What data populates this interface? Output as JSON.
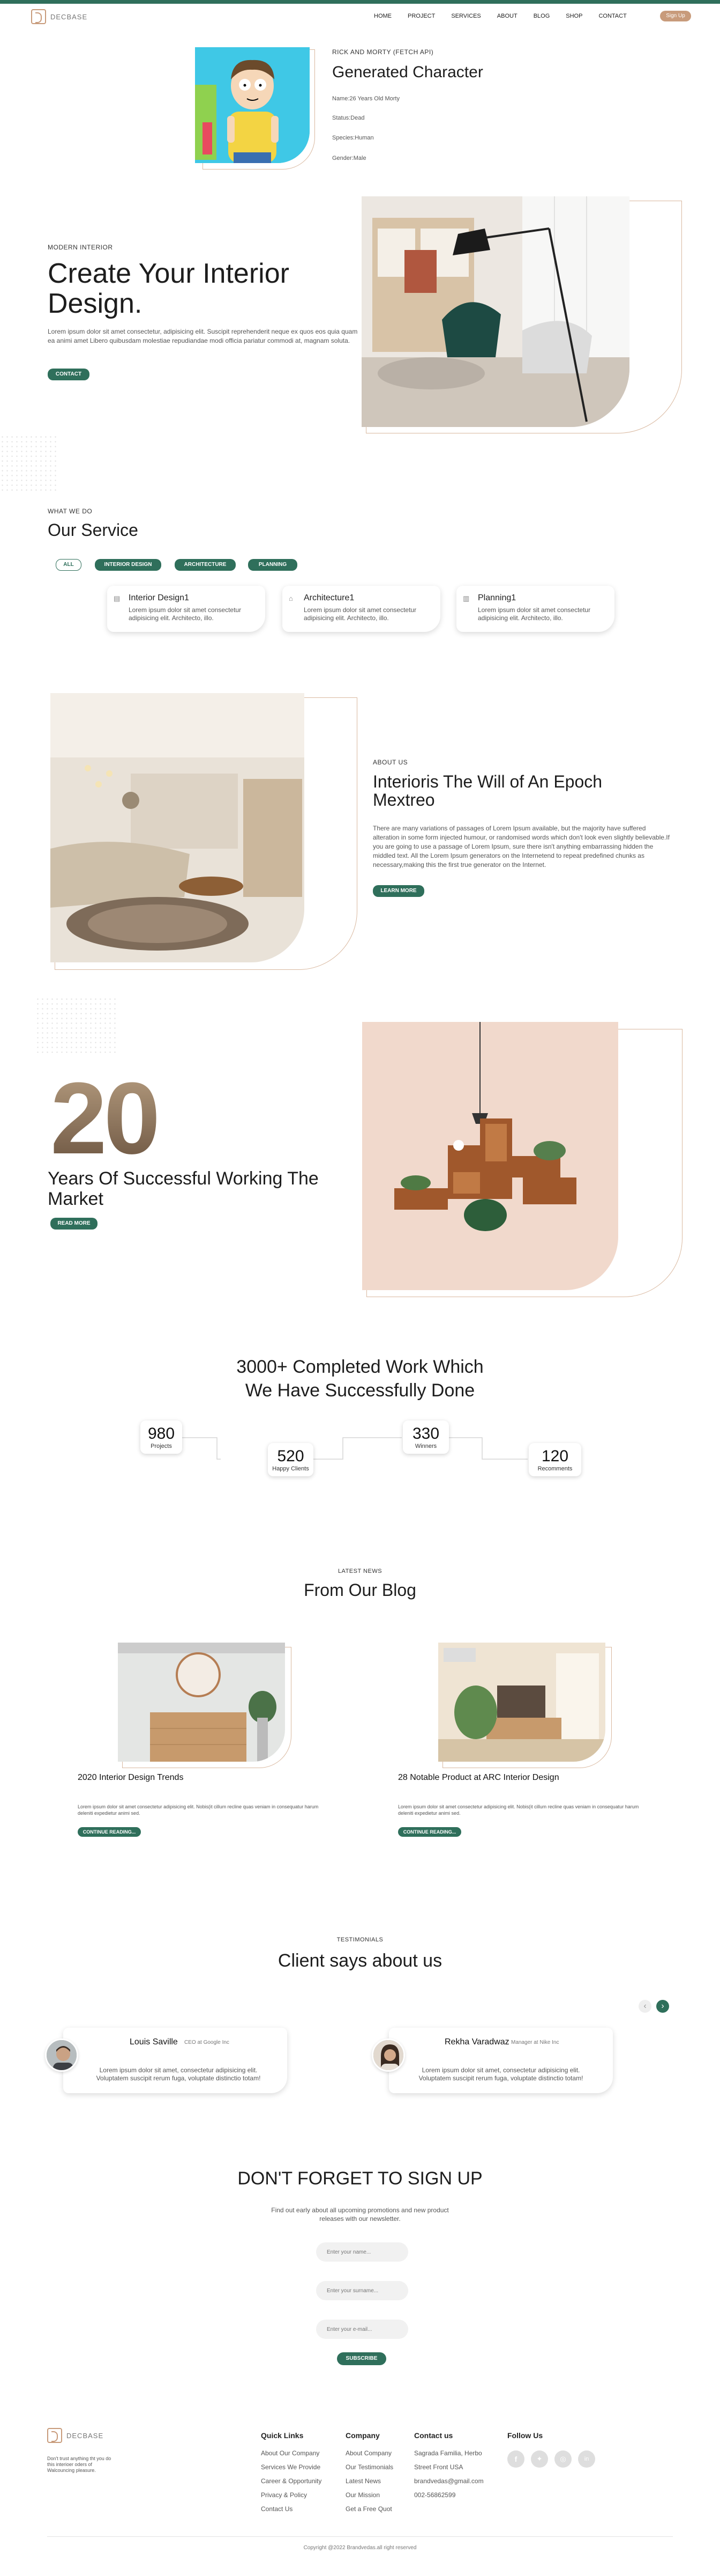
{
  "nav": {
    "brand": "DECBASE",
    "items": [
      "HOME",
      "PROJECT",
      "SERVICES",
      "ABOUT",
      "BLOG",
      "SHOP",
      "CONTACT"
    ],
    "signup": "Sign Up"
  },
  "character": {
    "kicker": "RICK AND MORTY (FETCH API)",
    "title": "Generated Character",
    "name": "Name:26 Years Old Morty",
    "status": "Status:Dead",
    "species": "Species:Human",
    "gender": "Gender:Male"
  },
  "hero": {
    "kicker": "MODERN INTERIOR",
    "title": "Create Your Interior Design.",
    "text": "Lorem ipsum dolor sit amet consectetur, adipisicing elit. Suscipit reprehenderit neque ex quos eos quia quam ea animi amet Libero quibusdam molestiae repudiandae modi officia pariatur commodi at, magnam soluta.",
    "button": "CONTACT"
  },
  "services": {
    "kicker": "WHAT WE DO",
    "title": "Our Service",
    "filters": [
      "ALL",
      "INTERIOR DESIGN",
      "ARCHITECTURE",
      "PLANNING"
    ],
    "cards": [
      {
        "title": "Interior Design1",
        "text": "Lorem ipsum dolor sit amet consectetur adipisicing elit. Architecto, illo."
      },
      {
        "title": "Architecture1",
        "text": "Lorem ipsum dolor sit amet consectetur adipisicing elit. Architecto, illo."
      },
      {
        "title": "Planning1",
        "text": "Lorem ipsum dolor sit amet consectetur adipisicing elit. Architecto, illo."
      }
    ]
  },
  "about": {
    "kicker": "ABOUT US",
    "title": "Interioris The Will of An Epoch Mextreo",
    "text": "There are many variations of passages of Lorem Ipsum available, but the majority have suffered alteration in some form injected humour, or randomised words which don't look even slightly believable.If you are going to use a passage of Lorem Ipsum, sure there isn't anything embarrassing hidden the middled text. All the Lorem Ipsum generators on the Internetend to repeat predefined chunks as necessary,making this the first true generator on the Internet.",
    "button": "LEARN MORE"
  },
  "years": {
    "number": "20",
    "title": "Years Of Successful Working The Market",
    "button": "READ MORE"
  },
  "completed": {
    "title_line1": "3000+ Completed Work Which",
    "title_line2": "We Have Successfully Done",
    "stats": [
      {
        "value": "980",
        "label": "Projects"
      },
      {
        "value": "520",
        "label": "Happy Clients"
      },
      {
        "value": "330",
        "label": "Winners"
      },
      {
        "value": "120",
        "label": "Recomments"
      }
    ]
  },
  "blog": {
    "kicker": "LATEST NEWS",
    "title": "From Our Blog",
    "posts": [
      {
        "title": "2020 Interior Design Trends",
        "text": "Lorem ipsum dolor sit amet consectetur adipisicing elit. Nobis(it cillum recline quas veniam in consequatur harum deleniti expedietur animi sed.",
        "button": "CONTINUE READING..."
      },
      {
        "title": "28 Notable Product at ARC Interior Design",
        "text": "Lorem ipsum dolor sit amet consectetur adipisicing elit. Nobis(it cillum recline quas veniam in consequatur harum deleniti expedietur animi sed.",
        "button": "CONTINUE READING..."
      }
    ]
  },
  "testimonials": {
    "kicker": "TESTIMONIALS",
    "title": "Client says about us",
    "items": [
      {
        "name": "Louis Saville",
        "role": "CEO at Google Inc",
        "text": "Lorem ipsum dolor sit amet, consectetur adipisicing elit. Voluptatem suscipit rerum fuga, voluptate distinctio totam!"
      },
      {
        "name": "Rekha Varadwaz",
        "role": "Manager at Nike Inc",
        "text": "Lorem ipsum dolor sit amet, consectetur adipisicing elit. Voluptatem suscipit rerum fuga, voluptate distinctio totam!"
      }
    ],
    "prev": "‹",
    "next": "›"
  },
  "newsletter": {
    "title": "DON'T FORGET TO SIGN UP",
    "text": "Find out early about all upcoming promotions and new product releases with our newsletter.",
    "name_placeholder": "Enter your name...",
    "surname_placeholder": "Enter your surname...",
    "email_placeholder": "Enter your e-mail...",
    "button": "SUBSCRIBE"
  },
  "footer": {
    "brand": "DECBASE",
    "tagline": "Don't trust anything tht you do this interioer oders of Walcouncing pleasure.",
    "quick_links": {
      "title": "Quick Links",
      "items": [
        "About Our Company",
        "Services We Provide",
        "Career & Opportunity",
        "Privacy & Policy",
        "Contact Us"
      ]
    },
    "company": {
      "title": "Company",
      "items": [
        "About Company",
        "Our Testimonials",
        "Latest News",
        "Our Mission",
        "Get a Free Quot"
      ]
    },
    "contact": {
      "title": "Contact us",
      "items": [
        "Sagrada Familia, Herbo",
        "Street Front USA",
        "brandvedas@gmail.com",
        "002-56862599"
      ]
    },
    "follow": {
      "title": "Follow Us"
    },
    "copyright": "Copyright @2022 Brandvedas.all right reserved"
  },
  "colors": {
    "accent": "#2f6f5b",
    "sand": "#c89b7b"
  }
}
